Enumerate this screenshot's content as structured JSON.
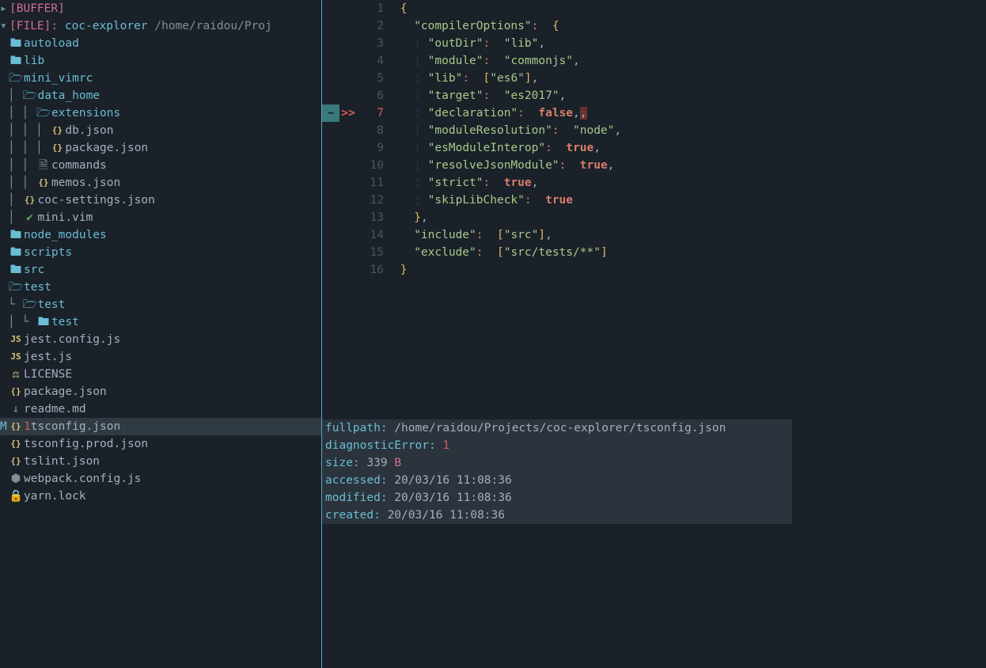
{
  "explorer": {
    "buffer_label": "[BUFFER]",
    "file_label": "[FILE]:",
    "project_name": "coc-explorer",
    "project_path": "/home/raidou/Proj",
    "selected_flag": "M",
    "selected_err": "1",
    "tree": [
      {
        "depth": 2,
        "icon": "folder",
        "label": "autoload",
        "cls": "folder"
      },
      {
        "depth": 2,
        "icon": "folder",
        "label": "lib",
        "cls": "folder"
      },
      {
        "depth": 2,
        "icon": "folder-open",
        "label": "mini_vimrc",
        "cls": "folder"
      },
      {
        "depth": 3,
        "icon": "folder-open",
        "label": "data_home",
        "cls": "folder",
        "pipe": true
      },
      {
        "depth": 4,
        "icon": "folder-open",
        "label": "extensions",
        "cls": "folder",
        "pipe": true
      },
      {
        "depth": 5,
        "icon": "json",
        "label": "db.json",
        "cls": "file",
        "pipe": true
      },
      {
        "depth": 5,
        "icon": "json",
        "label": "package.json",
        "cls": "file",
        "last": true,
        "pipe": true
      },
      {
        "depth": 4,
        "icon": "doc",
        "label": "commands",
        "cls": "file",
        "pipe": true
      },
      {
        "depth": 4,
        "icon": "json",
        "label": "memos.json",
        "cls": "file",
        "last": true,
        "pipe": true
      },
      {
        "depth": 3,
        "icon": "json",
        "label": "coc-settings.json",
        "cls": "file",
        "pipe": true
      },
      {
        "depth": 3,
        "icon": "vim",
        "label": "mini.vim",
        "cls": "file",
        "last": true,
        "pipe": true
      },
      {
        "depth": 2,
        "icon": "folder",
        "label": "node_modules",
        "cls": "folder"
      },
      {
        "depth": 2,
        "icon": "folder",
        "label": "scripts",
        "cls": "folder"
      },
      {
        "depth": 2,
        "icon": "folder",
        "label": "src",
        "cls": "folder"
      },
      {
        "depth": 2,
        "icon": "folder-open",
        "label": "test",
        "cls": "folder"
      },
      {
        "depth": 3,
        "icon": "folder-open",
        "label": "test",
        "cls": "folder",
        "last": true,
        "pipe": true,
        "corner": true
      },
      {
        "depth": 4,
        "icon": "folder",
        "label": "test",
        "cls": "folder",
        "last": true,
        "pipe": true,
        "corner": true
      },
      {
        "depth": 2,
        "icon": "js",
        "label": "jest.config.js",
        "cls": "file"
      },
      {
        "depth": 2,
        "icon": "js",
        "label": "jest.js",
        "cls": "file"
      },
      {
        "depth": 2,
        "icon": "license",
        "label": "LICENSE",
        "cls": "file"
      },
      {
        "depth": 2,
        "icon": "json",
        "label": "package.json",
        "cls": "file"
      },
      {
        "depth": 2,
        "icon": "md",
        "label": "readme.md",
        "cls": "file"
      },
      {
        "depth": 2,
        "icon": "json",
        "label": "tsconfig.json",
        "cls": "file",
        "selected": true
      },
      {
        "depth": 2,
        "icon": "json",
        "label": "tsconfig.prod.json",
        "cls": "file"
      },
      {
        "depth": 2,
        "icon": "json",
        "label": "tslint.json",
        "cls": "file"
      },
      {
        "depth": 2,
        "icon": "webpack",
        "label": "webpack.config.js",
        "cls": "file"
      },
      {
        "depth": 2,
        "icon": "lock",
        "label": "yarn.lock",
        "cls": "file"
      }
    ]
  },
  "editor": {
    "current_line": 7,
    "lines": [
      {
        "n": 1,
        "tokens": [
          [
            "brace",
            "{"
          ]
        ]
      },
      {
        "n": 2,
        "tokens": [
          [
            "ws",
            "  "
          ],
          [
            "key",
            "\"compilerOptions\""
          ],
          [
            "op",
            ":"
          ],
          [
            "ws",
            " "
          ],
          [
            "brace",
            "{"
          ]
        ]
      },
      {
        "n": 3,
        "tokens": [
          [
            "ws",
            "    "
          ],
          [
            "key",
            "\"outDir\""
          ],
          [
            "op",
            ":"
          ],
          [
            "ws",
            " "
          ],
          [
            "str",
            "\"lib\""
          ],
          [
            "punct",
            ","
          ]
        ]
      },
      {
        "n": 4,
        "tokens": [
          [
            "ws",
            "    "
          ],
          [
            "key",
            "\"module\""
          ],
          [
            "op",
            ":"
          ],
          [
            "ws",
            " "
          ],
          [
            "str",
            "\"commonjs\""
          ],
          [
            "punct",
            ","
          ]
        ]
      },
      {
        "n": 5,
        "tokens": [
          [
            "ws",
            "    "
          ],
          [
            "key",
            "\"lib\""
          ],
          [
            "op",
            ":"
          ],
          [
            "ws",
            " "
          ],
          [
            "brace",
            "["
          ],
          [
            "str",
            "\"es6\""
          ],
          [
            "brace",
            "]"
          ],
          [
            "punct",
            ","
          ]
        ]
      },
      {
        "n": 6,
        "tokens": [
          [
            "ws",
            "    "
          ],
          [
            "key",
            "\"target\""
          ],
          [
            "op",
            ":"
          ],
          [
            "ws",
            " "
          ],
          [
            "str",
            "\"es2017\""
          ],
          [
            "punct",
            ","
          ]
        ]
      },
      {
        "n": 7,
        "tokens": [
          [
            "ws",
            "    "
          ],
          [
            "key",
            "\"declaration\""
          ],
          [
            "op",
            ":"
          ],
          [
            "ws",
            " "
          ],
          [
            "bool",
            "false"
          ],
          [
            "punct",
            ","
          ],
          [
            "err",
            ","
          ]
        ],
        "modified": true,
        "error": true
      },
      {
        "n": 8,
        "tokens": [
          [
            "ws",
            "    "
          ],
          [
            "key",
            "\"moduleResolution\""
          ],
          [
            "op",
            ":"
          ],
          [
            "ws",
            " "
          ],
          [
            "str",
            "\"node\""
          ],
          [
            "punct",
            ","
          ]
        ]
      },
      {
        "n": 9,
        "tokens": [
          [
            "ws",
            "    "
          ],
          [
            "key",
            "\"esModuleInterop\""
          ],
          [
            "op",
            ":"
          ],
          [
            "ws",
            " "
          ],
          [
            "bool",
            "true"
          ],
          [
            "punct",
            ","
          ]
        ]
      },
      {
        "n": 10,
        "tokens": [
          [
            "ws",
            "    "
          ],
          [
            "key",
            "\"resolveJsonModule\""
          ],
          [
            "op",
            ":"
          ],
          [
            "ws",
            " "
          ],
          [
            "bool",
            "true"
          ],
          [
            "punct",
            ","
          ]
        ]
      },
      {
        "n": 11,
        "tokens": [
          [
            "ws",
            "    "
          ],
          [
            "key",
            "\"strict\""
          ],
          [
            "op",
            ":"
          ],
          [
            "ws",
            " "
          ],
          [
            "bool",
            "true"
          ],
          [
            "punct",
            ","
          ]
        ]
      },
      {
        "n": 12,
        "tokens": [
          [
            "ws",
            "    "
          ],
          [
            "key",
            "\"skipLibCheck\""
          ],
          [
            "op",
            ":"
          ],
          [
            "ws",
            " "
          ],
          [
            "bool",
            "true"
          ]
        ]
      },
      {
        "n": 13,
        "tokens": [
          [
            "ws",
            "  "
          ],
          [
            "brace",
            "}"
          ],
          [
            "punct",
            ","
          ]
        ]
      },
      {
        "n": 14,
        "tokens": [
          [
            "ws",
            "  "
          ],
          [
            "key",
            "\"include\""
          ],
          [
            "op",
            ":"
          ],
          [
            "ws",
            " "
          ],
          [
            "brace",
            "["
          ],
          [
            "str",
            "\"src\""
          ],
          [
            "brace",
            "]"
          ],
          [
            "punct",
            ","
          ]
        ]
      },
      {
        "n": 15,
        "tokens": [
          [
            "ws",
            "  "
          ],
          [
            "key",
            "\"exclude\""
          ],
          [
            "op",
            ":"
          ],
          [
            "ws",
            " "
          ],
          [
            "brace",
            "["
          ],
          [
            "str",
            "\"src/tests/**\""
          ],
          [
            "brace",
            "]"
          ]
        ]
      },
      {
        "n": 16,
        "tokens": [
          [
            "brace",
            "}"
          ]
        ]
      }
    ]
  },
  "info": {
    "fullpath_label": "fullpath:",
    "fullpath": "/home/raidou/Projects/coc-explorer/tsconfig.json",
    "diag_label": "diagnosticError:",
    "diag": "1",
    "size_label": "size:",
    "size_num": "339",
    "size_unit": "B",
    "accessed_label": "accessed:",
    "accessed": "20/03/16 11:08:36",
    "modified_label": "modified:",
    "modified": "20/03/16 11:08:36",
    "created_label": "created:",
    "created": "20/03/16 11:08:36"
  },
  "icons": {
    "folder": "🖿",
    "folder-open": "🗁",
    "json": "{}",
    "doc": "🗎",
    "vim": "✔",
    "js": "JS",
    "license": "⚖",
    "md": "↓",
    "webpack": "⬢",
    "lock": "🔒"
  }
}
